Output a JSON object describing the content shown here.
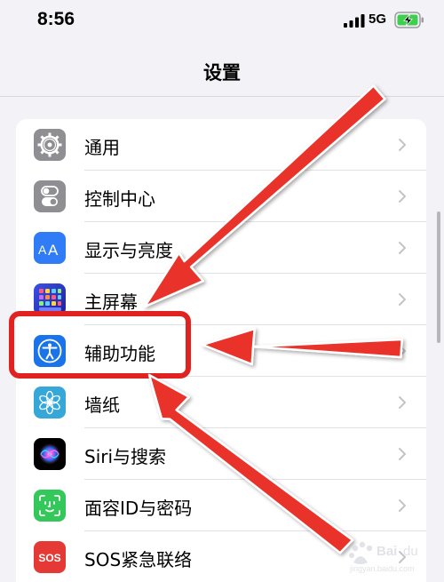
{
  "status_bar": {
    "time": "8:56",
    "network": "5G",
    "signal_icon": "cellular-signal-icon",
    "battery_icon": "battery-charging-icon"
  },
  "nav": {
    "title": "设置"
  },
  "settings": {
    "items": [
      {
        "label": "通用",
        "icon": "gear-icon",
        "icon_color": "#8e8e93"
      },
      {
        "label": "控制中心",
        "icon": "toggle-icon",
        "icon_color": "#8e8e93"
      },
      {
        "label": "显示与亮度",
        "icon": "text-size-icon",
        "icon_color": "#2f7cf6"
      },
      {
        "label": "主屏幕",
        "icon": "app-grid-icon",
        "icon_color": "#2c2cb8"
      },
      {
        "label": "辅助功能",
        "icon": "accessibility-icon",
        "icon_color": "#1a73e8"
      },
      {
        "label": "墙纸",
        "icon": "flower-icon",
        "icon_color": "#35a7d9"
      },
      {
        "label": "Siri与搜索",
        "icon": "siri-icon",
        "icon_color": "#1c1c1e"
      },
      {
        "label": "面容ID与密码",
        "icon": "face-id-icon",
        "icon_color": "#34c759"
      },
      {
        "label": "SOS紧急联络",
        "icon": "sos-icon",
        "icon_color": "#e53935",
        "icon_text": "SOS"
      }
    ]
  },
  "annotations": {
    "highlight_color": "#e02320",
    "arrow_color": "#e8322b"
  }
}
